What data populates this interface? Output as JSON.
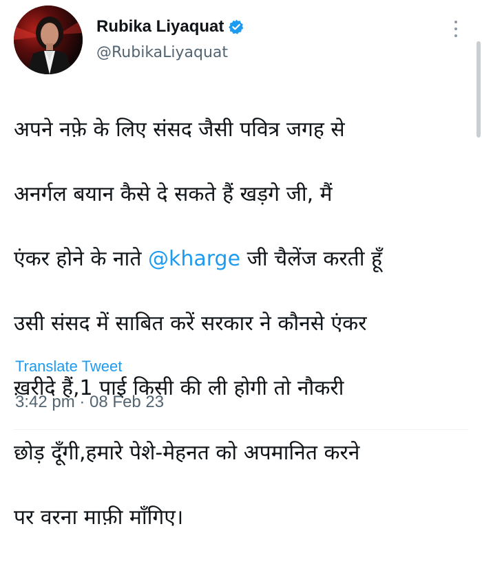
{
  "author": {
    "display_name": "Rubika Liyaquat",
    "handle": "@RubikaLiyaquat",
    "verified": true
  },
  "tweet": {
    "line1": "अपने नफ़े के लिए संसद जैसी पवित्र जगह से",
    "line2": "अनर्गल बयान कैसे दे सकते हैं खड़गे जी, मैं",
    "line3_pre": "एंकर होने के नाते ",
    "mention": "@kharge",
    "line3_post": " जी चैलेंज करती हूँ",
    "line4": "उसी संसद में साबित करें सरकार ने कौनसे एंकर",
    "line5": "ख़रीदे हैं,1 पाई किसी की ली होगी तो नौकरी",
    "line6": "छोड़ दूँगी,हमारे पेशे-मेहनत को अपमानित करने",
    "line7": "पर वरना माफ़ी माँगिए।"
  },
  "actions": {
    "translate_label": "Translate Tweet"
  },
  "meta": {
    "time": "3:42 pm",
    "separator": " · ",
    "date": "08 Feb 23"
  },
  "icons": {
    "verified": "verified-badge-icon",
    "more": "more-options-icon"
  },
  "colors": {
    "accent": "#1d9bf0",
    "secondary_text": "#536471",
    "primary_text": "#0f1419"
  }
}
